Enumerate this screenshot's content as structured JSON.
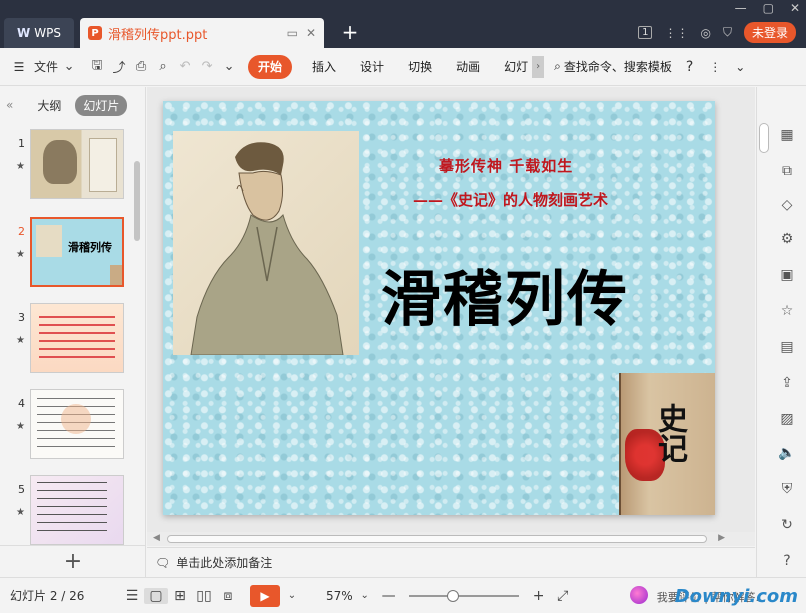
{
  "app": {
    "home_tab": "WPS",
    "doc_tab": "滑稽列传ppt.ppt",
    "login_label": "未登录",
    "page_badge": "1"
  },
  "toolbar": {
    "file_label": "文件",
    "tabs": [
      "开始",
      "插入",
      "设计",
      "切换",
      "动画",
      "幻灯"
    ],
    "search_label": "查找命令、搜索模板",
    "help": "?"
  },
  "left_panel": {
    "outline_tab": "大纲",
    "slides_tab": "幻灯片",
    "thumbnails": [
      {
        "num": "1",
        "title": ""
      },
      {
        "num": "2",
        "title": "滑稽列传"
      },
      {
        "num": "3",
        "title": ""
      },
      {
        "num": "4",
        "title": ""
      },
      {
        "num": "5",
        "title": ""
      }
    ]
  },
  "slide": {
    "subtitle1": "摹形传神  千载如生",
    "subtitle2": "——《史记》的人物刻画艺术",
    "title": "滑稽列传",
    "book_text": "史记"
  },
  "notes": {
    "placeholder": "单击此处添加备注"
  },
  "status": {
    "slide_info": "幻灯片 2 / 26",
    "zoom": "57%",
    "zoom_level": 0.4,
    "feedback": "我要评价 | 帮你解答...",
    "watermark": "Downyi.com"
  },
  "colors": {
    "accent": "#e8572b",
    "titlebar": "#2b3140",
    "slide_bg": "#a9dbe6",
    "slide_red": "#c0171e"
  }
}
